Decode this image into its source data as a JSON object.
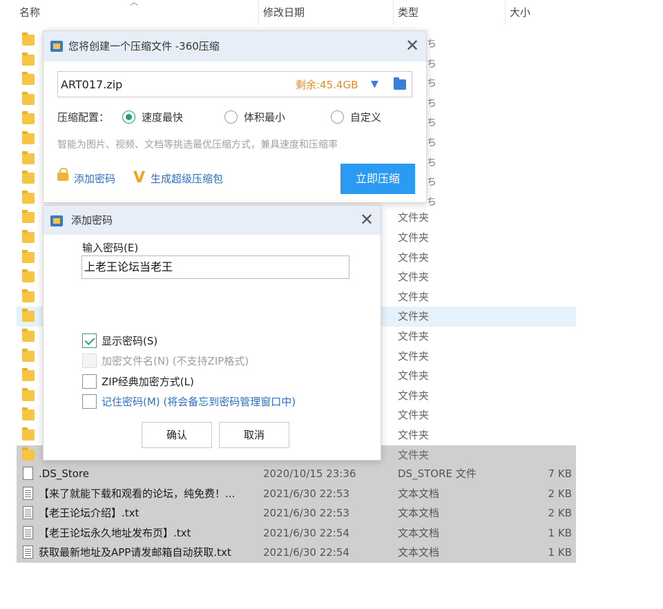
{
  "columns": {
    "name": "名称",
    "date": "修改日期",
    "type": "类型",
    "size": "大小"
  },
  "folder_type": "文件夹",
  "files": [
    {
      "name": ".DS_Store",
      "date": "2020/10/15 23:36",
      "type": "DS_STORE 文件",
      "size": "7 KB",
      "kind": "file"
    },
    {
      "name": "【来了就能下载和观看的论坛，纯免费！...",
      "date": "2021/6/30 22:53",
      "type": "文本文档",
      "size": "2 KB",
      "kind": "txt"
    },
    {
      "name": "【老王论坛介绍】.txt",
      "date": "2021/6/30 22:53",
      "type": "文本文档",
      "size": "2 KB",
      "kind": "txt"
    },
    {
      "name": "【老王论坛永久地址发布页】.txt",
      "date": "2021/6/30 22:54",
      "type": "文本文档",
      "size": "1 KB",
      "kind": "txt"
    },
    {
      "name": "获取最新地址及APP请发邮箱自动获取.txt",
      "date": "2021/6/30 22:54",
      "type": "文本文档",
      "size": "1 KB",
      "kind": "txt"
    }
  ],
  "compress_dialog": {
    "title": "您将创建一个压缩文件 -360压缩",
    "filename": "ART017.zip",
    "free_space": "剩余:45.4GB",
    "config_label": "压缩配置：",
    "options": [
      "速度最快",
      "体积最小",
      "自定义"
    ],
    "hint": "智能为图片、视频、文档等挑选最优压缩方式，兼具速度和压缩率",
    "add_password": "添加密码",
    "super_pack": "生成超级压缩包",
    "compress_now": "立即压缩"
  },
  "password_dialog": {
    "title": "添加密码",
    "input_label": "输入密码(E)",
    "password_value": "上老王论坛当老王",
    "show_password": "显示密码(S)",
    "encrypt_names": "加密文件名(N) (不支持ZIP格式)",
    "zip_classic": "ZIP经典加密方式(L)",
    "remember": "记住密码(M) (将会备忘到密码管理窗口中)",
    "ok": "确认",
    "cancel": "取消"
  },
  "edge_fragments": [
    "ち",
    "ち",
    "ち",
    "ち",
    "ち",
    "ち",
    "ち",
    "ち",
    "ち"
  ]
}
